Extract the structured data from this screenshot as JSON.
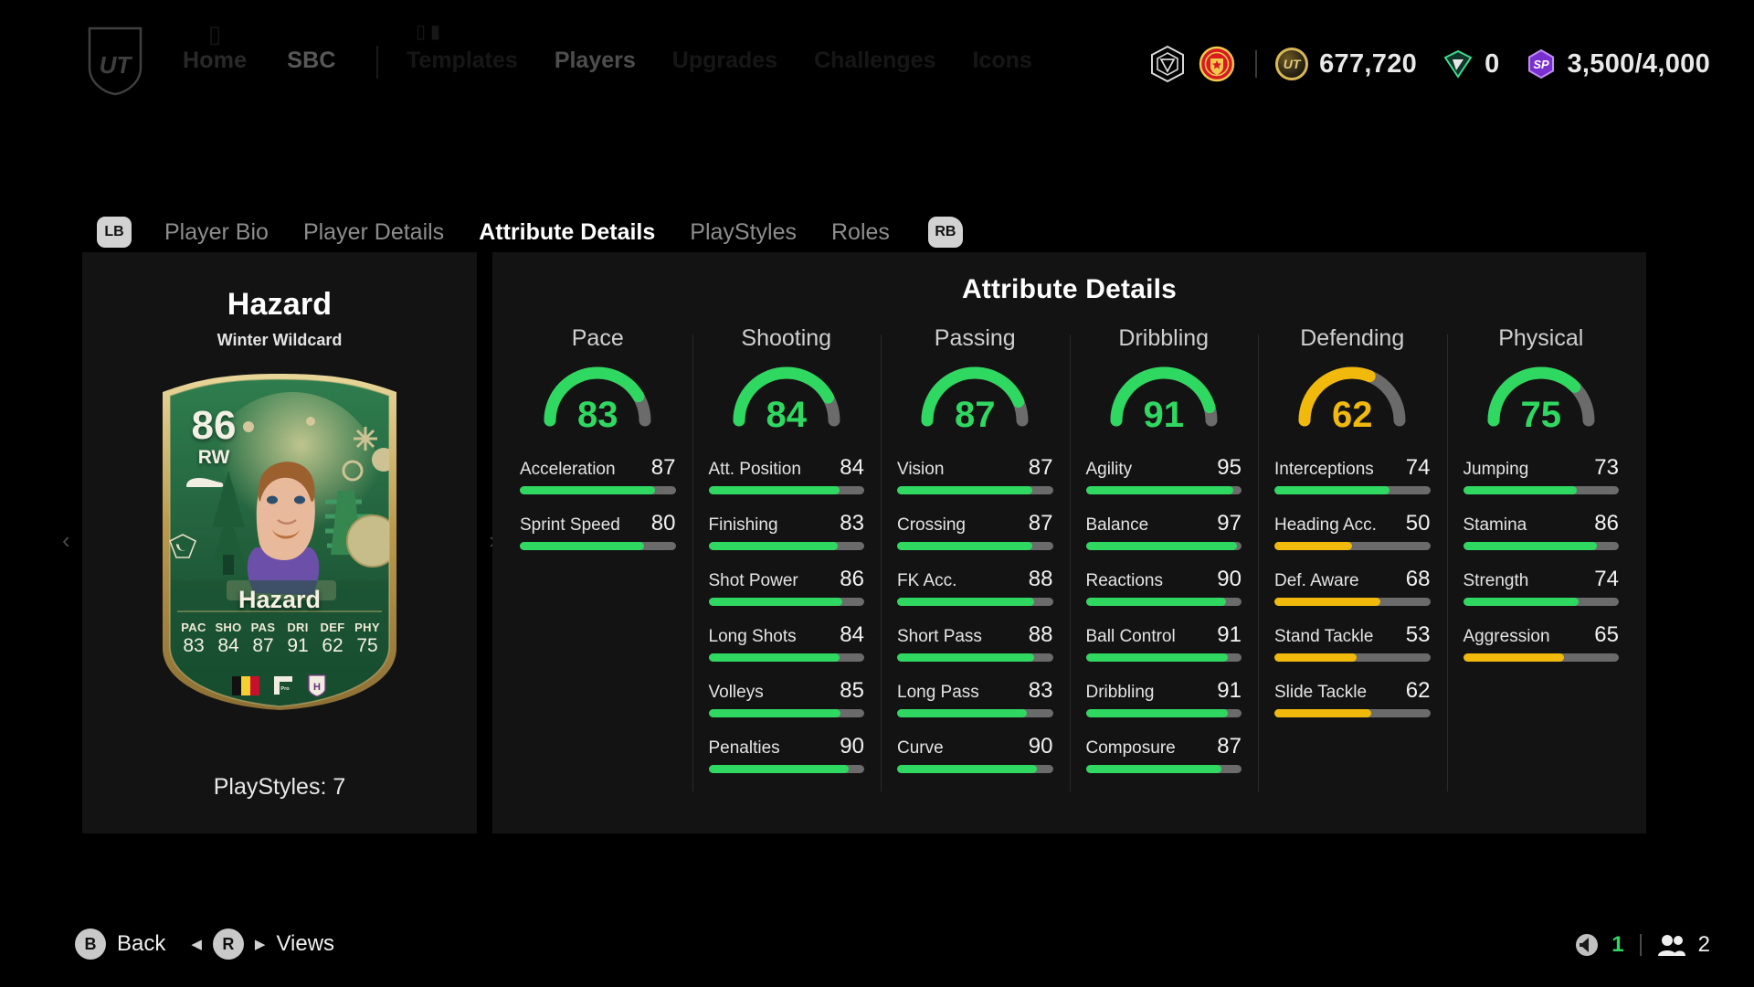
{
  "nav": {
    "logo_text": "UT",
    "main_items": [
      {
        "label": "Home",
        "active": false
      },
      {
        "label": "SBC",
        "active": true
      }
    ],
    "sub_items": [
      {
        "label": "Templates",
        "active": false
      },
      {
        "label": "Players",
        "active": true
      },
      {
        "label": "Upgrades",
        "active": false
      },
      {
        "label": "Challenges",
        "active": false
      },
      {
        "label": "Icons",
        "active": false
      }
    ]
  },
  "header": {
    "coins_label": "UT",
    "coins": "677,720",
    "points": "0",
    "sp_label": "SP",
    "sp": "3,500/4,000"
  },
  "tabs": {
    "left_bumper": "LB",
    "right_bumper": "RB",
    "items": [
      {
        "label": "Player Bio",
        "active": false
      },
      {
        "label": "Player Details",
        "active": false
      },
      {
        "label": "Attribute Details",
        "active": true
      },
      {
        "label": "PlayStyles",
        "active": false
      },
      {
        "label": "Roles",
        "active": false
      }
    ]
  },
  "player": {
    "name": "Hazard",
    "variant": "Winter Wildcard",
    "playstyles_line": "PlayStyles: 7",
    "card": {
      "rating": "86",
      "position": "RW",
      "name": "Hazard",
      "stats": [
        {
          "label": "PAC",
          "value": "83"
        },
        {
          "label": "SHO",
          "value": "84"
        },
        {
          "label": "PAS",
          "value": "87"
        },
        {
          "label": "DRI",
          "value": "91"
        },
        {
          "label": "DEF",
          "value": "62"
        },
        {
          "label": "PHY",
          "value": "75"
        }
      ],
      "nation": "Belgium",
      "league": "Pro League",
      "club": "Anderlecht"
    }
  },
  "attributes": {
    "title": "Attribute Details",
    "columns": [
      {
        "name": "Pace",
        "overall": 83,
        "color": "#2fd861",
        "rows": [
          {
            "label": "Acceleration",
            "value": 87
          },
          {
            "label": "Sprint Speed",
            "value": 80
          }
        ]
      },
      {
        "name": "Shooting",
        "overall": 84,
        "color": "#2fd861",
        "rows": [
          {
            "label": "Att. Position",
            "value": 84
          },
          {
            "label": "Finishing",
            "value": 83
          },
          {
            "label": "Shot Power",
            "value": 86
          },
          {
            "label": "Long Shots",
            "value": 84
          },
          {
            "label": "Volleys",
            "value": 85
          },
          {
            "label": "Penalties",
            "value": 90
          }
        ]
      },
      {
        "name": "Passing",
        "overall": 87,
        "color": "#2fd861",
        "rows": [
          {
            "label": "Vision",
            "value": 87
          },
          {
            "label": "Crossing",
            "value": 87
          },
          {
            "label": "FK Acc.",
            "value": 88
          },
          {
            "label": "Short Pass",
            "value": 88
          },
          {
            "label": "Long Pass",
            "value": 83
          },
          {
            "label": "Curve",
            "value": 90
          }
        ]
      },
      {
        "name": "Dribbling",
        "overall": 91,
        "color": "#2fd861",
        "rows": [
          {
            "label": "Agility",
            "value": 95
          },
          {
            "label": "Balance",
            "value": 97
          },
          {
            "label": "Reactions",
            "value": 90
          },
          {
            "label": "Ball Control",
            "value": 91
          },
          {
            "label": "Dribbling",
            "value": 91
          },
          {
            "label": "Composure",
            "value": 87
          }
        ]
      },
      {
        "name": "Defending",
        "overall": 62,
        "color": "#f0b90b",
        "rows": [
          {
            "label": "Interceptions",
            "value": 74
          },
          {
            "label": "Heading Acc.",
            "value": 50
          },
          {
            "label": "Def. Aware",
            "value": 68
          },
          {
            "label": "Stand Tackle",
            "value": 53
          },
          {
            "label": "Slide Tackle",
            "value": 62
          }
        ]
      },
      {
        "name": "Physical",
        "overall": 75,
        "color": "#2fd861",
        "rows": [
          {
            "label": "Jumping",
            "value": 73
          },
          {
            "label": "Stamina",
            "value": 86
          },
          {
            "label": "Strength",
            "value": 74
          },
          {
            "label": "Aggression",
            "value": 65
          }
        ]
      }
    ],
    "bar_colors": {
      "high": "#2fd861",
      "mid": "#f0b90b",
      "low": "#e02b3c",
      "track": "#6b6b6b"
    },
    "thresholds": {
      "high": 70,
      "mid": 50
    }
  },
  "bottom": {
    "back_button": "B",
    "back_label": "Back",
    "views_button": "R",
    "views_label": "Views",
    "audio_count": "1",
    "players_count": "2"
  }
}
